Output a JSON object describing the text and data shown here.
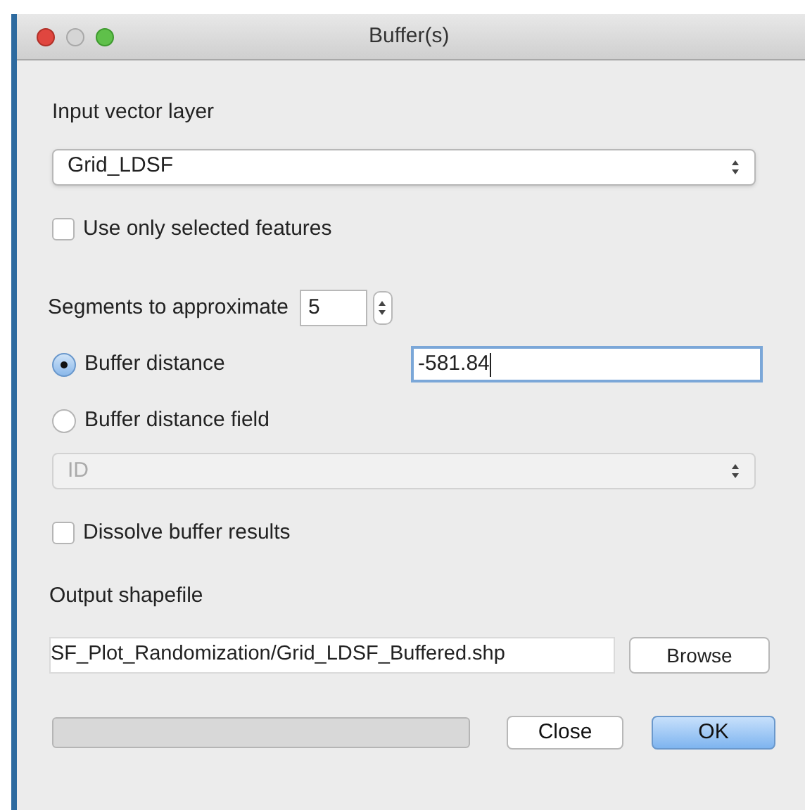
{
  "window": {
    "title": "Buffer(s)"
  },
  "input_layer": {
    "label": "Input vector layer",
    "value": "Grid_LDSF"
  },
  "use_selected": {
    "label": "Use only selected features",
    "checked": false
  },
  "segments": {
    "label": "Segments to approximate",
    "value": "5"
  },
  "distance_options": [
    {
      "label": "Buffer distance",
      "selected": true,
      "value": "-581.84"
    },
    {
      "label": "Buffer distance field",
      "selected": false
    }
  ],
  "field_combo": {
    "value": "ID",
    "disabled": true
  },
  "dissolve": {
    "label": "Dissolve buffer results",
    "checked": false
  },
  "output": {
    "label": "Output shapefile",
    "value": "SF_Plot_Randomization/Grid_LDSF_Buffered.shp",
    "button": "Browse"
  },
  "progress": {
    "level": 0
  },
  "buttons": [
    {
      "label": "Close",
      "default": false
    },
    {
      "label": "OK",
      "default": true
    }
  ]
}
